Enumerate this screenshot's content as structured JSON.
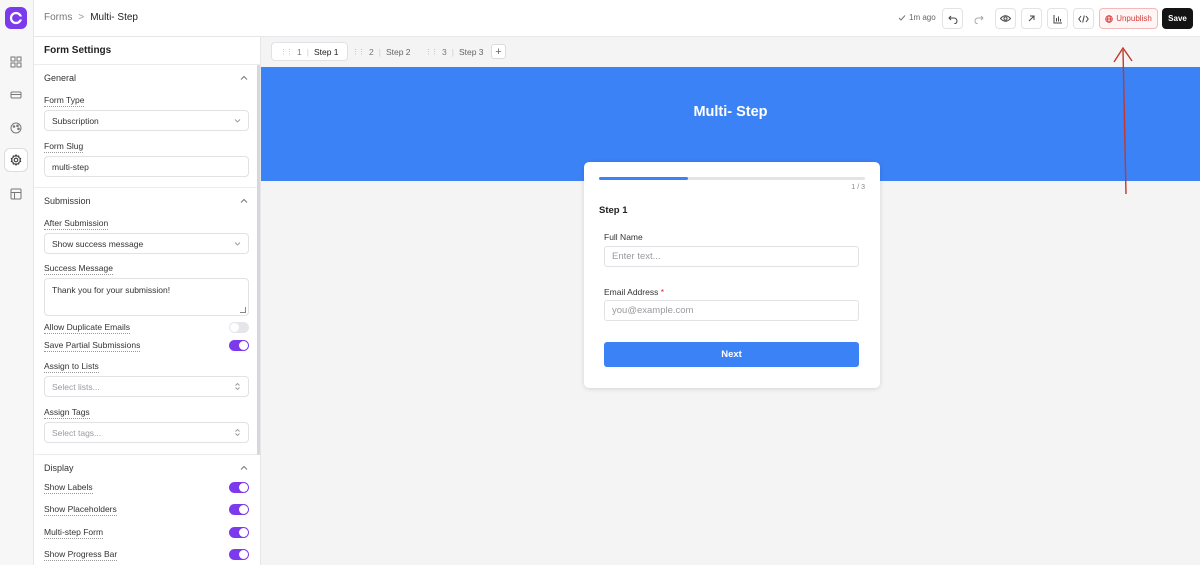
{
  "breadcrumb": {
    "parent": "Forms",
    "separator": ">",
    "current": "Multi- Step"
  },
  "toolbar": {
    "saved_status": "1m ago",
    "unpublish_label": "Unpublish",
    "save_label": "Save",
    "icons": [
      "undo-icon",
      "redo-icon",
      "preview-eye-icon",
      "open-external-icon",
      "analytics-chart-icon",
      "embed-code-icon"
    ]
  },
  "rail": {
    "icons": [
      "app-logo",
      "grid-icon",
      "layout-icon",
      "palette-icon",
      "settings-icon",
      "table-icon"
    ],
    "active": "settings-icon"
  },
  "panel": {
    "title": "Form Settings",
    "general": {
      "heading": "General",
      "form_type_label": "Form Type",
      "form_type_value": "Subscription",
      "form_slug_label": "Form Slug",
      "form_slug_value": "multi-step"
    },
    "submission": {
      "heading": "Submission",
      "after_label": "After Submission",
      "after_value": "Show success message",
      "success_label": "Success Message",
      "success_value": "Thank you for your submission!",
      "allow_duplicates_label": "Allow Duplicate Emails",
      "allow_duplicates_on": false,
      "save_partial_label": "Save Partial Submissions",
      "save_partial_on": true,
      "lists_label": "Assign to Lists",
      "lists_placeholder": "Select lists...",
      "tags_label": "Assign Tags",
      "tags_placeholder": "Select tags..."
    },
    "display": {
      "heading": "Display",
      "show_labels_label": "Show Labels",
      "show_placeholders_label": "Show Placeholders",
      "multistep_label": "Multi-step Form",
      "show_progress_label": "Show Progress Bar",
      "toggles_on": [
        true,
        true,
        true,
        true
      ]
    }
  },
  "steps": [
    {
      "num": "1",
      "label": "Step 1",
      "active": true
    },
    {
      "num": "2",
      "label": "Step 2",
      "active": false
    },
    {
      "num": "3",
      "label": "Step 3",
      "active": false
    }
  ],
  "canvas": {
    "banner_title": "Multi- Step",
    "progress_fraction": 0.333,
    "progress_text": "1 / 3",
    "step_title": "Step 1",
    "full_name_label": "Full Name",
    "full_name_placeholder": "Enter text...",
    "email_label": "Email Address",
    "email_required_mark": "*",
    "email_placeholder": "you@example.com",
    "next_label": "Next"
  },
  "colors": {
    "accent": "#3b82f6",
    "toggle_on": "#7c3aed",
    "unpublish": "#d23c3c",
    "annotation": "#c0392b"
  }
}
